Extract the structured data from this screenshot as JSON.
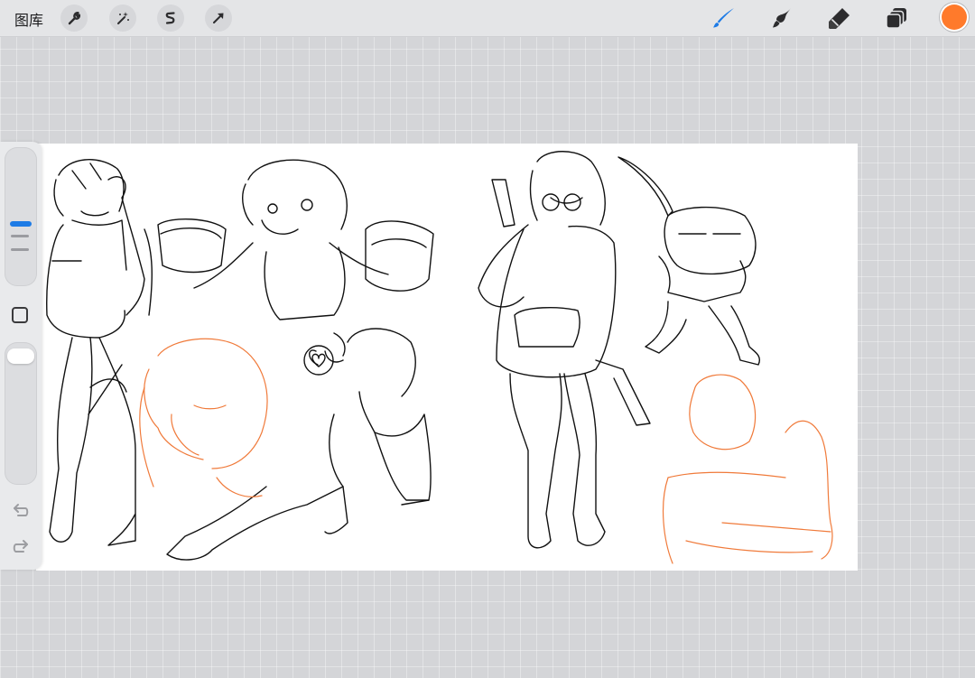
{
  "topbar": {
    "gallery_label": "图库",
    "actions": [
      "wrench-icon",
      "magic-wand-icon",
      "selection-s-icon",
      "transform-arrow-icon"
    ],
    "tools": [
      "brush-icon",
      "smudge-icon",
      "eraser-icon",
      "layers-icon"
    ],
    "active_tool": "brush-icon",
    "current_color": "#ff7a2b"
  },
  "sidebar": {
    "size_slider": "brush-size-slider",
    "modify_button": "eyedropper-square",
    "opacity_slider": "brush-opacity-slider",
    "undo": "undo-icon",
    "redo": "redo-icon"
  },
  "colors": {
    "accent": "#1d7be6",
    "orange": "#ff7a2b",
    "ink": "#111111",
    "sketch_orange": "#f07a3a"
  }
}
